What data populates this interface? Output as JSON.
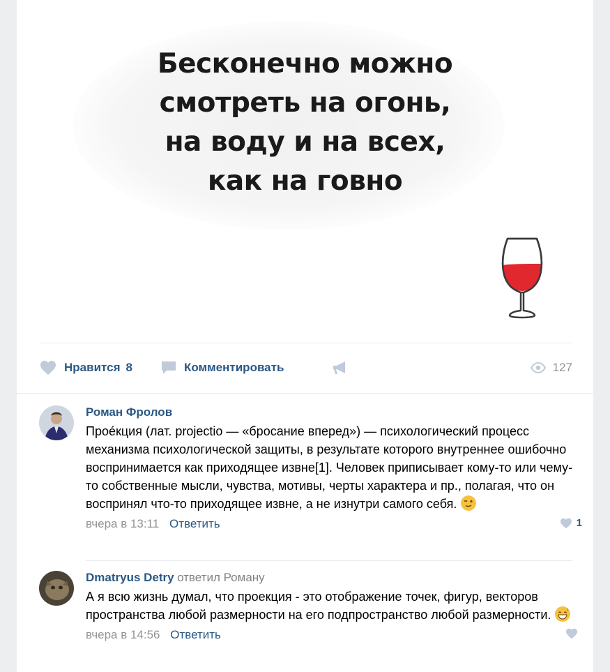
{
  "post": {
    "quote_text": "Бесконечно можно\nсмотреть на огонь,\nна воду и на всех,\nкак на говно",
    "actions": {
      "like_label": "Нравится",
      "like_count": "8",
      "comment_label": "Комментировать",
      "views_count": "127"
    },
    "icons": {
      "like": "heart-icon",
      "comment": "comment-bubble-icon",
      "share": "megaphone-icon",
      "views": "eye-icon",
      "illustration": "wine-glass-icon"
    }
  },
  "comments": [
    {
      "author": "Роман Фролов",
      "reply_to": "",
      "text": "Проéкция (лат. projectio — «бросание вперед») — психологический процесс механизма психологической защиты, в результате которого внутреннее ошибочно воспринимается как приходящее извне[1]. Человек приписывает кому-то или чему-то собственные мысли, чувства, мотивы, черты характера и пр., полагая, что он воспринял что-то приходящее извне, а не изнутри самого себя.",
      "emoji": "winking-face-emoji",
      "time": "вчера в 13:11",
      "reply_label": "Ответить",
      "likes": "1"
    },
    {
      "author": "Dmatryus Detry",
      "reply_to": "ответил Роману",
      "text": "А я всю жизнь думал, что проекция - это отображение точек, фигур, векторов пространства любой размерности на его подпространство любой размерности.",
      "emoji": "grinning-sweat-emoji",
      "time": "вчера в 14:56",
      "reply_label": "Ответить",
      "likes": ""
    }
  ],
  "colors": {
    "page_bg": "#edeef0",
    "link": "#2a5885",
    "meta": "#939393",
    "wine": "#e0282e"
  }
}
